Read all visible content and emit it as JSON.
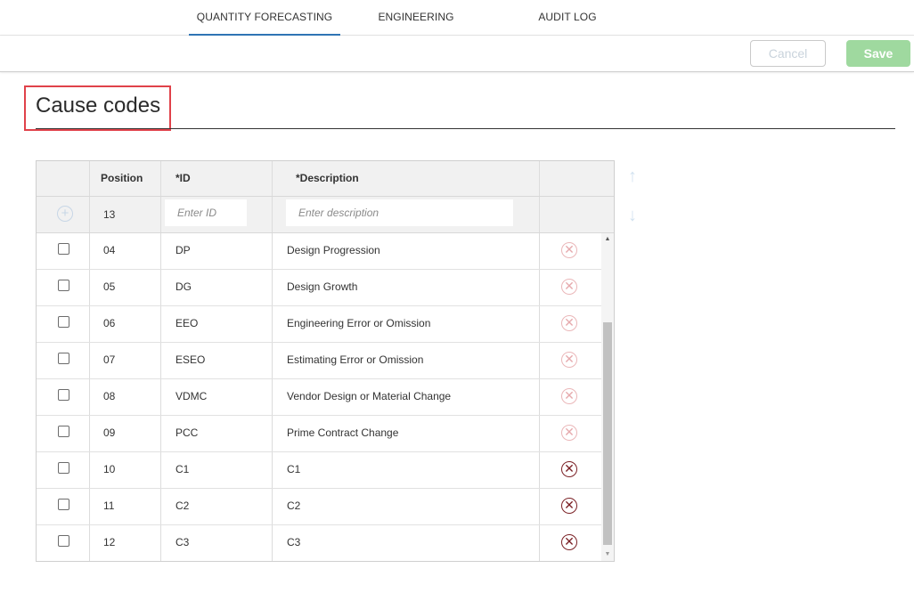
{
  "tabs": [
    {
      "label": "QUANTITY FORECASTING",
      "active": true
    },
    {
      "label": "ENGINEERING",
      "active": false
    },
    {
      "label": "AUDIT LOG",
      "active": false
    }
  ],
  "toolbar": {
    "cancel_label": "Cancel",
    "save_label": "Save"
  },
  "page": {
    "title": "Cause codes"
  },
  "grid": {
    "columns": [
      "",
      "Position",
      "*ID",
      "*Description",
      ""
    ],
    "new_row": {
      "position": "13",
      "id_placeholder": "Enter ID",
      "description_placeholder": "Enter description"
    },
    "rows": [
      {
        "position": "04",
        "id": "DP",
        "description": "Design Progression",
        "delete_enabled": false
      },
      {
        "position": "05",
        "id": "DG",
        "description": "Design Growth",
        "delete_enabled": false
      },
      {
        "position": "06",
        "id": "EEO",
        "description": "Engineering Error or Omission",
        "delete_enabled": false
      },
      {
        "position": "07",
        "id": "ESEO",
        "description": "Estimating Error or Omission",
        "delete_enabled": false
      },
      {
        "position": "08",
        "id": "VDMC",
        "description": "Vendor Design or Material Change",
        "delete_enabled": false
      },
      {
        "position": "09",
        "id": "PCC",
        "description": "Prime Contract Change",
        "delete_enabled": false
      },
      {
        "position": "10",
        "id": "C1",
        "description": "C1",
        "delete_enabled": true
      },
      {
        "position": "11",
        "id": "C2",
        "description": "C2",
        "delete_enabled": true
      },
      {
        "position": "12",
        "id": "C3",
        "description": "C3",
        "delete_enabled": true
      }
    ]
  },
  "icons": {
    "add": "plus-circle-icon",
    "delete": "close-circle-icon",
    "move_up": "arrow-up-icon",
    "move_down": "arrow-down-icon"
  },
  "colors": {
    "tab_accent": "#2f74b5",
    "save_button": "#9fd99f",
    "title_highlight": "#e0424a",
    "delete_active": "#7a1f24",
    "delete_inactive": "#eab6b8"
  }
}
